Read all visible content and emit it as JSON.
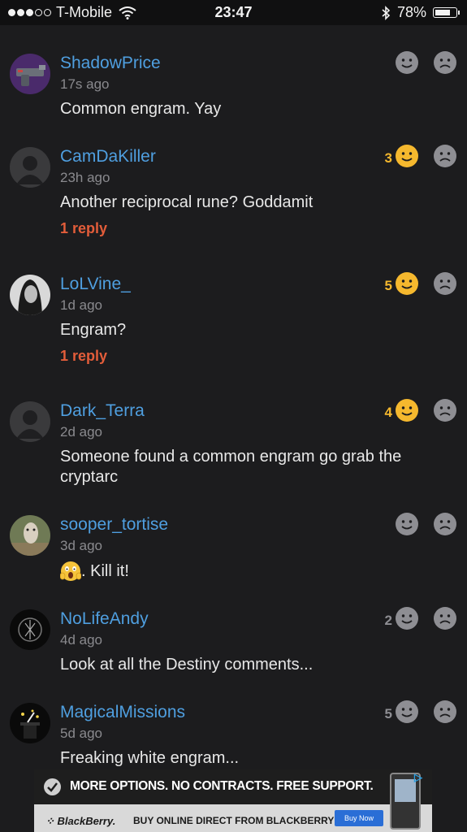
{
  "status": {
    "carrier": "T-Mobile",
    "time": "23:47",
    "battery": "78%",
    "battery_level": 0.78
  },
  "comments": [
    {
      "username": "ShadowPrice",
      "time": "17s ago",
      "text": "Common engram. Yay",
      "score": "",
      "reply": ""
    },
    {
      "username": "CamDaKiller",
      "time": "23h ago",
      "text": "Another reciprocal rune? Goddamit",
      "score": "3",
      "reply": "1 reply"
    },
    {
      "username": "LoLVine_",
      "time": "1d ago",
      "text": "Engram?",
      "score": "5",
      "reply": "1 reply"
    },
    {
      "username": "Dark_Terra",
      "time": "2d ago",
      "text": "Someone found a common engram go grab the cryptarc",
      "score": "4",
      "reply": ""
    },
    {
      "username": "sooper_tortise",
      "time": "3d ago",
      "text": ". Kill it!",
      "score": "",
      "reply": ""
    },
    {
      "username": "NoLifeAndy",
      "time": "4d ago",
      "text": "Look at all the Destiny comments...",
      "score": "2",
      "reply": ""
    },
    {
      "username": "MagicalMissions",
      "time": "5d ago",
      "text": "Freaking white engram...",
      "score": "5",
      "reply": ""
    }
  ],
  "icons": {
    "like": "smiley-face-icon",
    "dislike": "sad-face-icon",
    "scream": "screaming-face-emoji-icon"
  },
  "colors": {
    "username": "#4f9fe0",
    "reply": "#e35d3a",
    "active": "#f5b82e",
    "inactive": "#8e8e93"
  },
  "ad": {
    "headline": "MORE OPTIONS. NO CONTRACTS. FREE SUPPORT.",
    "brand": "BlackBerry.",
    "tagline": "BUY ONLINE DIRECT FROM BLACKBERRY",
    "button": "Buy Now"
  }
}
